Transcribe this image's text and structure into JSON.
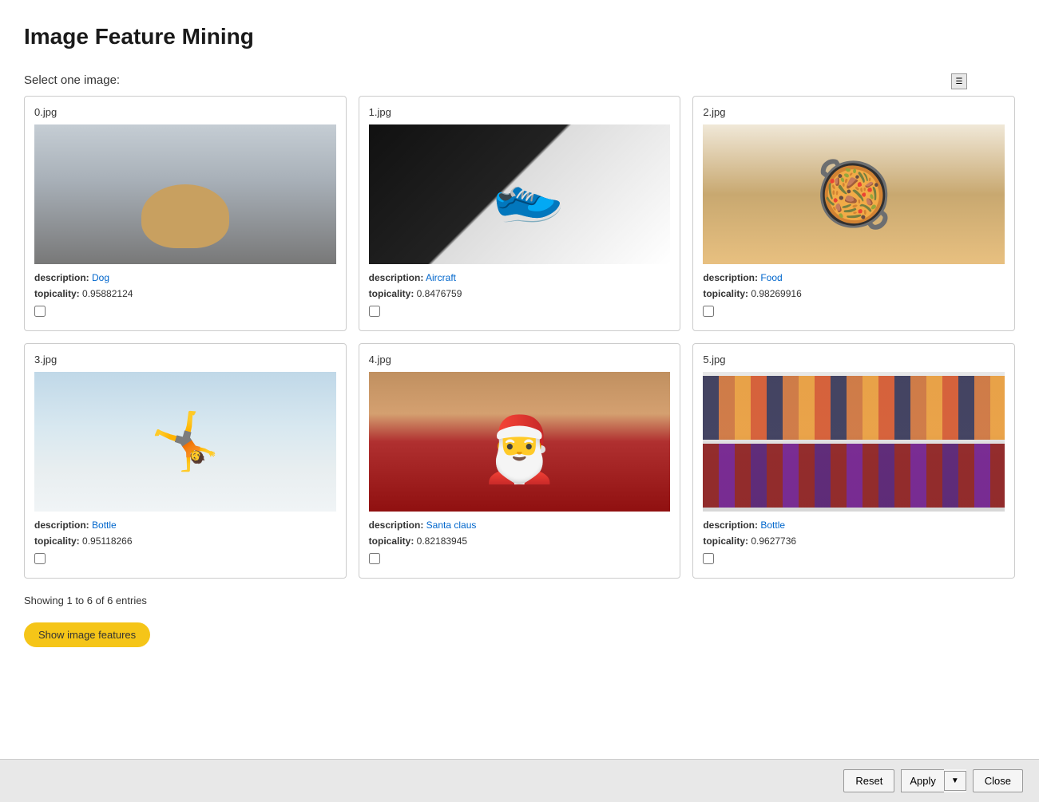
{
  "page": {
    "title": "Image Feature Mining"
  },
  "section": {
    "label": "Select one image:"
  },
  "grid_controls": {
    "minimize": "▬",
    "close": "✕",
    "menu": "☰"
  },
  "images": [
    {
      "id": 0,
      "filename": "0.jpg",
      "description_label": "description:",
      "description_value": "Dog",
      "topicality_label": "topicality:",
      "topicality_value": "0.95882124",
      "type": "dog"
    },
    {
      "id": 1,
      "filename": "1.jpg",
      "description_label": "description:",
      "description_value": "Aircraft",
      "topicality_label": "topicality:",
      "topicality_value": "0.8476759",
      "type": "shoe"
    },
    {
      "id": 2,
      "filename": "2.jpg",
      "description_label": "description:",
      "description_value": "Food",
      "topicality_label": "topicality:",
      "topicality_value": "0.98269916",
      "type": "food"
    },
    {
      "id": 3,
      "filename": "3.jpg",
      "description_label": "description:",
      "description_value": "Bottle",
      "topicality_label": "topicality:",
      "topicality_value": "0.95118266",
      "type": "snow"
    },
    {
      "id": 4,
      "filename": "4.jpg",
      "description_label": "description:",
      "description_value": "Santa claus",
      "topicality_label": "topicality:",
      "topicality_value": "0.82183945",
      "type": "santa"
    },
    {
      "id": 5,
      "filename": "5.jpg",
      "description_label": "description:",
      "description_value": "Bottle",
      "topicality_label": "topicality:",
      "topicality_value": "0.9627736",
      "type": "bottles"
    }
  ],
  "pagination": {
    "text": "Showing 1 to 6 of 6 entries"
  },
  "buttons": {
    "show_features": "Show image features",
    "reset": "Reset",
    "apply": "Apply",
    "close": "Close"
  }
}
